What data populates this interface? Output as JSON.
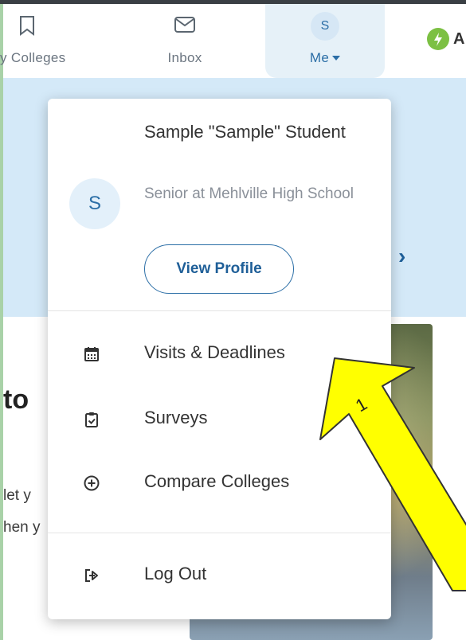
{
  "topnav": {
    "items": [
      {
        "label": "My Colleges",
        "icon": "bookmark-icon"
      },
      {
        "label": "Inbox",
        "icon": "envelope-icon"
      },
      {
        "label": "Me",
        "avatar_initial": "S",
        "icon": "caret-down-icon"
      }
    ],
    "right_partial_text": "A"
  },
  "background": {
    "heading_fragment": "to",
    "line1_fragment": "let y",
    "line2_fragment": "hen y"
  },
  "menu": {
    "user": {
      "avatar_initial": "S",
      "name": "Sample \"Sample\" Student",
      "subtitle": "Senior at Mehlville High School"
    },
    "view_profile_label": "View Profile",
    "items": [
      {
        "label": "Visits & Deadlines",
        "icon": "calendar-icon"
      },
      {
        "label": "Surveys",
        "icon": "clipboard-check-icon"
      },
      {
        "label": "Compare Colleges",
        "icon": "plus-circle-icon"
      }
    ],
    "logout_label": "Log Out",
    "logout_icon": "logout-icon"
  },
  "annotation": {
    "arrow_label": "1",
    "arrow_color": "#ffff00"
  },
  "colors": {
    "accent": "#2b6ea6",
    "hero_bg": "#d4e9f8",
    "me_tab_bg": "#e6f1f8"
  }
}
